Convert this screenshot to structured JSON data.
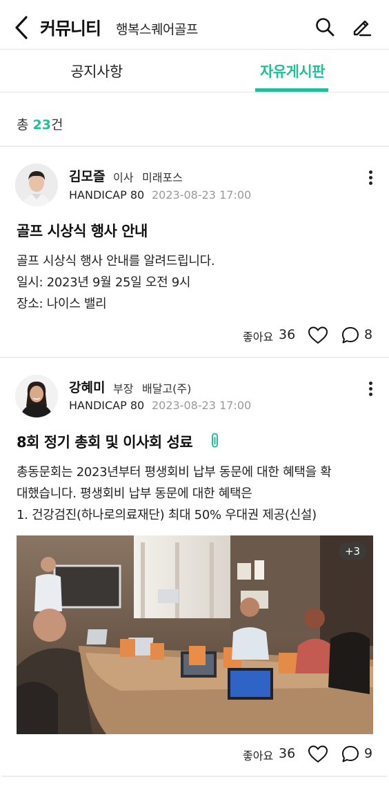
{
  "header": {
    "title": "커뮤니티",
    "subtitle": "행복스퀘어골프",
    "back_icon": "chevron-left-icon",
    "search_icon": "search-icon",
    "edit_icon": "pencil-icon"
  },
  "tabs": [
    {
      "label": "공지사항",
      "active": false
    },
    {
      "label": "자유게시판",
      "active": true
    }
  ],
  "accent_color": "#1fbf9a",
  "count": {
    "prefix": "총 ",
    "value": "23",
    "suffix": "건"
  },
  "posts": [
    {
      "author": "김모즐",
      "position": "이사",
      "company": "미래포스",
      "handicap": "HANDICAP 80",
      "date": "2023-08-23 17:00",
      "title": "골프 시상식 행사 안내",
      "has_attachment": false,
      "body": [
        "골프 시상식 행사 안내를 알려드립니다.",
        "일시: 2023년 9월 25일 오전 9시",
        "장소: 나이스 밸리"
      ],
      "likes_label": "좋아요",
      "likes": "36",
      "comments": "8"
    },
    {
      "author": "강혜미",
      "position": "부장",
      "company": "배달고(주)",
      "handicap": "HANDICAP 80",
      "date": "2023-08-23 17:00",
      "title": "8회 정기 총회 및 이사회 성료",
      "has_attachment": true,
      "body": [
        "총동문회는 2023년부터 평생회비 납부 동문에 대한 혜택을 확",
        "대했습니다. 평생회비 납부 동문에 대한 혜택은",
        "1. 건강검진(하나로의료재단) 최대 50% 우대권 제공(신설)"
      ],
      "image_more": "+3",
      "likes_label": "좋아요",
      "likes": "36",
      "comments": "9"
    }
  ]
}
